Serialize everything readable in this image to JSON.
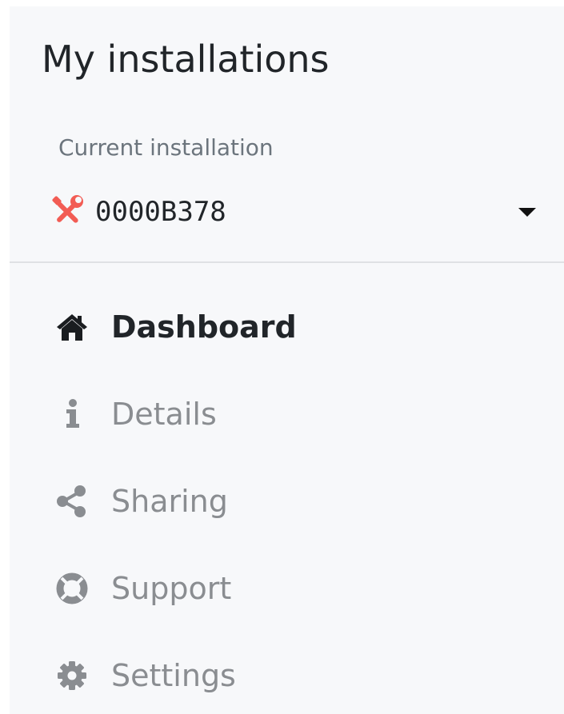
{
  "header": {
    "title": "My installations"
  },
  "installation_selector": {
    "label": "Current installation",
    "current_id": "0000B378",
    "status_icon": "tools-icon",
    "status_color": "#f25c54",
    "dropdown_icon": "caret-down-icon"
  },
  "nav": {
    "items": [
      {
        "label": "Dashboard",
        "icon": "home-icon",
        "active": true
      },
      {
        "label": "Details",
        "icon": "info-icon",
        "active": false
      },
      {
        "label": "Sharing",
        "icon": "share-icon",
        "active": false
      },
      {
        "label": "Support",
        "icon": "life-ring-icon",
        "active": false
      },
      {
        "label": "Settings",
        "icon": "gear-icon",
        "active": false
      }
    ]
  },
  "colors": {
    "panel_background": "#f7f8fa",
    "active_text": "#212529",
    "inactive_text": "#8a8d91",
    "muted_label": "#6c757d",
    "divider": "#dfe1e4"
  }
}
